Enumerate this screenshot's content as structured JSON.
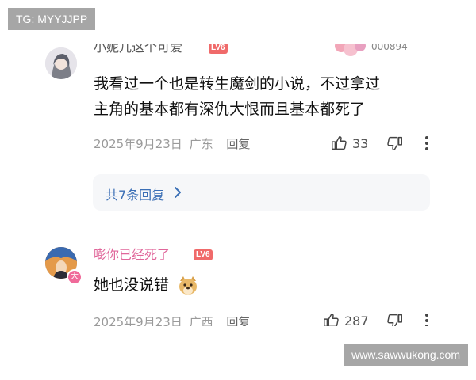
{
  "watermarks": {
    "top": "TG: MYYJJPP",
    "bottom": "www.sawwukong.com"
  },
  "comment1": {
    "username": "小妮儿这个可爱",
    "level": "LV6",
    "text_line1": "我看过一个也是转生魔剑的小说，不过拿过",
    "text_line2": "主角的基本都有深仇大恨而且基本都死了",
    "date": "2025年9月23日",
    "location": "广东",
    "reply_label": "回复",
    "like_count": "33",
    "icons": [
      "thumb-up-icon",
      "thumb-down-icon",
      "more-vertical-icon"
    ]
  },
  "reply_summary": {
    "label": "共7条回复",
    "icon": "chevron-right-icon"
  },
  "comment2": {
    "username": "嘭你已经死了",
    "level": "LV6",
    "text": "她也没说错",
    "emoji": "doge-emoji",
    "date": "2025年9月23日",
    "location": "广西",
    "reply_label": "回复",
    "like_count": "287",
    "badge": "大",
    "icons": [
      "thumb-up-icon",
      "thumb-down-icon",
      "more-vertical-icon"
    ]
  },
  "colors": {
    "username_pink": "#e0669a",
    "level_red": "#f06a6a",
    "link_blue": "#3b6fb6",
    "meta_gray": "#9a9a9a"
  }
}
